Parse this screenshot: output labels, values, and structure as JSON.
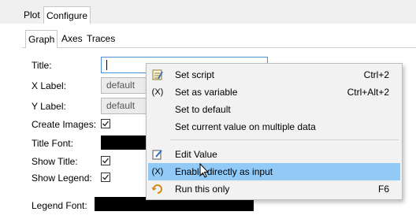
{
  "outer_tabs": [
    "Plot",
    "Configure"
  ],
  "inner_tabs": [
    "Graph",
    "Axes",
    "Traces"
  ],
  "form": {
    "title_label": "Title:",
    "title_value": "",
    "xlabel_label": "X Label:",
    "xlabel_value": "default",
    "ylabel_label": "Y Label:",
    "ylabel_value": "default",
    "create_images_label": "Create Images:",
    "title_font_label": "Title Font:",
    "show_title_label": "Show Title:",
    "show_legend_label": "Show Legend:",
    "legend_font_label": "Legend Font:",
    "create_images_checked": true,
    "show_title_checked": true,
    "show_legend_checked": true
  },
  "context_menu": {
    "items": [
      {
        "label": "Set script",
        "shortcut": "Ctrl+2",
        "icon": "script-icon"
      },
      {
        "label": "Set as variable",
        "shortcut": "Ctrl+Alt+2",
        "icon": "(X)"
      },
      {
        "label": "Set to default",
        "shortcut": "",
        "icon": ""
      },
      {
        "label": "Set current value on multiple data",
        "shortcut": "",
        "icon": ""
      },
      {
        "label": "Edit Value",
        "shortcut": "",
        "icon": "edit-icon"
      },
      {
        "label": "Enable directly as input",
        "shortcut": "",
        "icon": "(X)",
        "highlighted": true
      },
      {
        "label": "Run this only",
        "shortcut": "F6",
        "icon": "run-icon"
      }
    ]
  },
  "colors": {
    "highlight": "#91c9f7",
    "font_swatch": "#000000"
  }
}
